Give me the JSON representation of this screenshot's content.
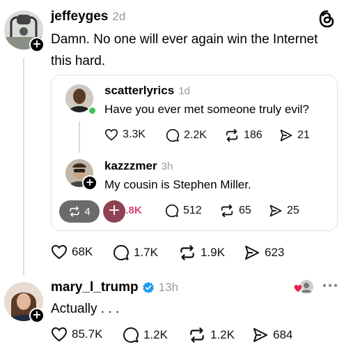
{
  "post1": {
    "username": "jeffeyges",
    "time": "2d",
    "text_line1": "Damn. No one will ever again win the Internet",
    "text_line2": "this hard.",
    "stats": {
      "likes": "68K",
      "replies": "1.7K",
      "reposts": "1.9K",
      "shares": "623"
    }
  },
  "quote": {
    "post1": {
      "username": "scatterlyrics",
      "time": "1d",
      "text": "Have you ever met someone truly evil?",
      "stats": {
        "likes": "3.3K",
        "replies": "2.2K",
        "reposts": "186",
        "shares": "21"
      }
    },
    "post2": {
      "username": "kazzzmer",
      "time": "3h",
      "text": "My cousin is Stephen Miller.",
      "stats": {
        "reposts_pill": "4",
        "likes": "9.8K",
        "replies": "512",
        "reposts": "65",
        "shares": "25"
      }
    }
  },
  "post2": {
    "username": "mary_l_trump",
    "time": "13h",
    "text": "Actually . . .",
    "stats": {
      "likes": "85.7K",
      "replies": "1.2K",
      "reposts": "1.2K",
      "shares": "684"
    }
  },
  "icons": {
    "app_logo": "threads-logo-icon",
    "like": "heart-icon",
    "reply": "speech-bubble-icon",
    "repost": "repost-arrows-icon",
    "share": "send-icon",
    "more": "more-dots-icon"
  },
  "colors": {
    "verified": "#1d9bf0",
    "online": "#3ac45a",
    "pink": "#d7437c",
    "plum": "#8e4253"
  }
}
